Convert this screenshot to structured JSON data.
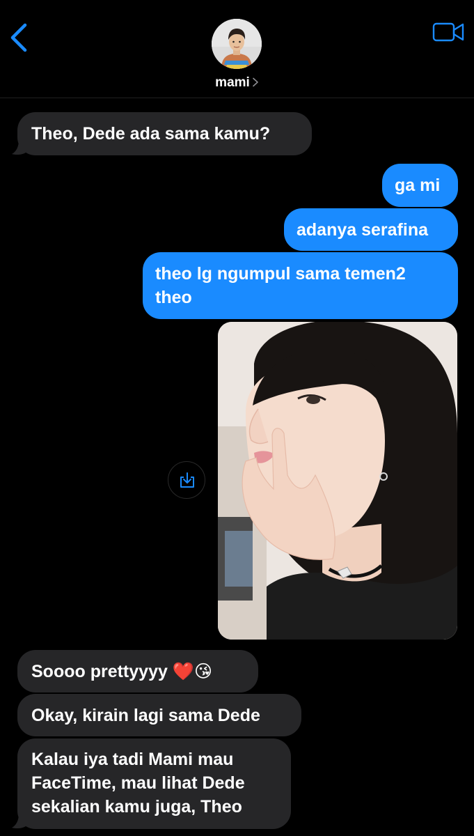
{
  "header": {
    "contact_name": "mami",
    "back_icon": "chevron-left-icon",
    "video_icon": "video-camera-icon",
    "accent_color": "#1a8bff"
  },
  "messages": [
    {
      "direction": "incoming",
      "text": "Theo, Dede ada sama kamu?"
    },
    {
      "direction": "outgoing",
      "text": "ga mi"
    },
    {
      "direction": "outgoing",
      "text": "adanya serafina"
    },
    {
      "direction": "outgoing",
      "line1": "theo lg ngumpul sama temen2",
      "line2": "theo"
    },
    {
      "direction": "outgoing",
      "type": "photo",
      "save_icon": "save-download-icon"
    },
    {
      "direction": "incoming",
      "text": "Soooo prettyyyy",
      "emoji1": "❤️",
      "emoji2": "😘"
    },
    {
      "direction": "incoming",
      "text": "Okay, kirain lagi sama Dede"
    },
    {
      "direction": "incoming",
      "line1": "Kalau iya tadi Mami mau",
      "line2": "FaceTime, mau lihat Dede",
      "line3": "sekalian kamu juga, Theo"
    }
  ],
  "colors": {
    "incoming_bubble": "#262628",
    "outgoing_bubble": "#1a8bff",
    "background": "#000000"
  }
}
